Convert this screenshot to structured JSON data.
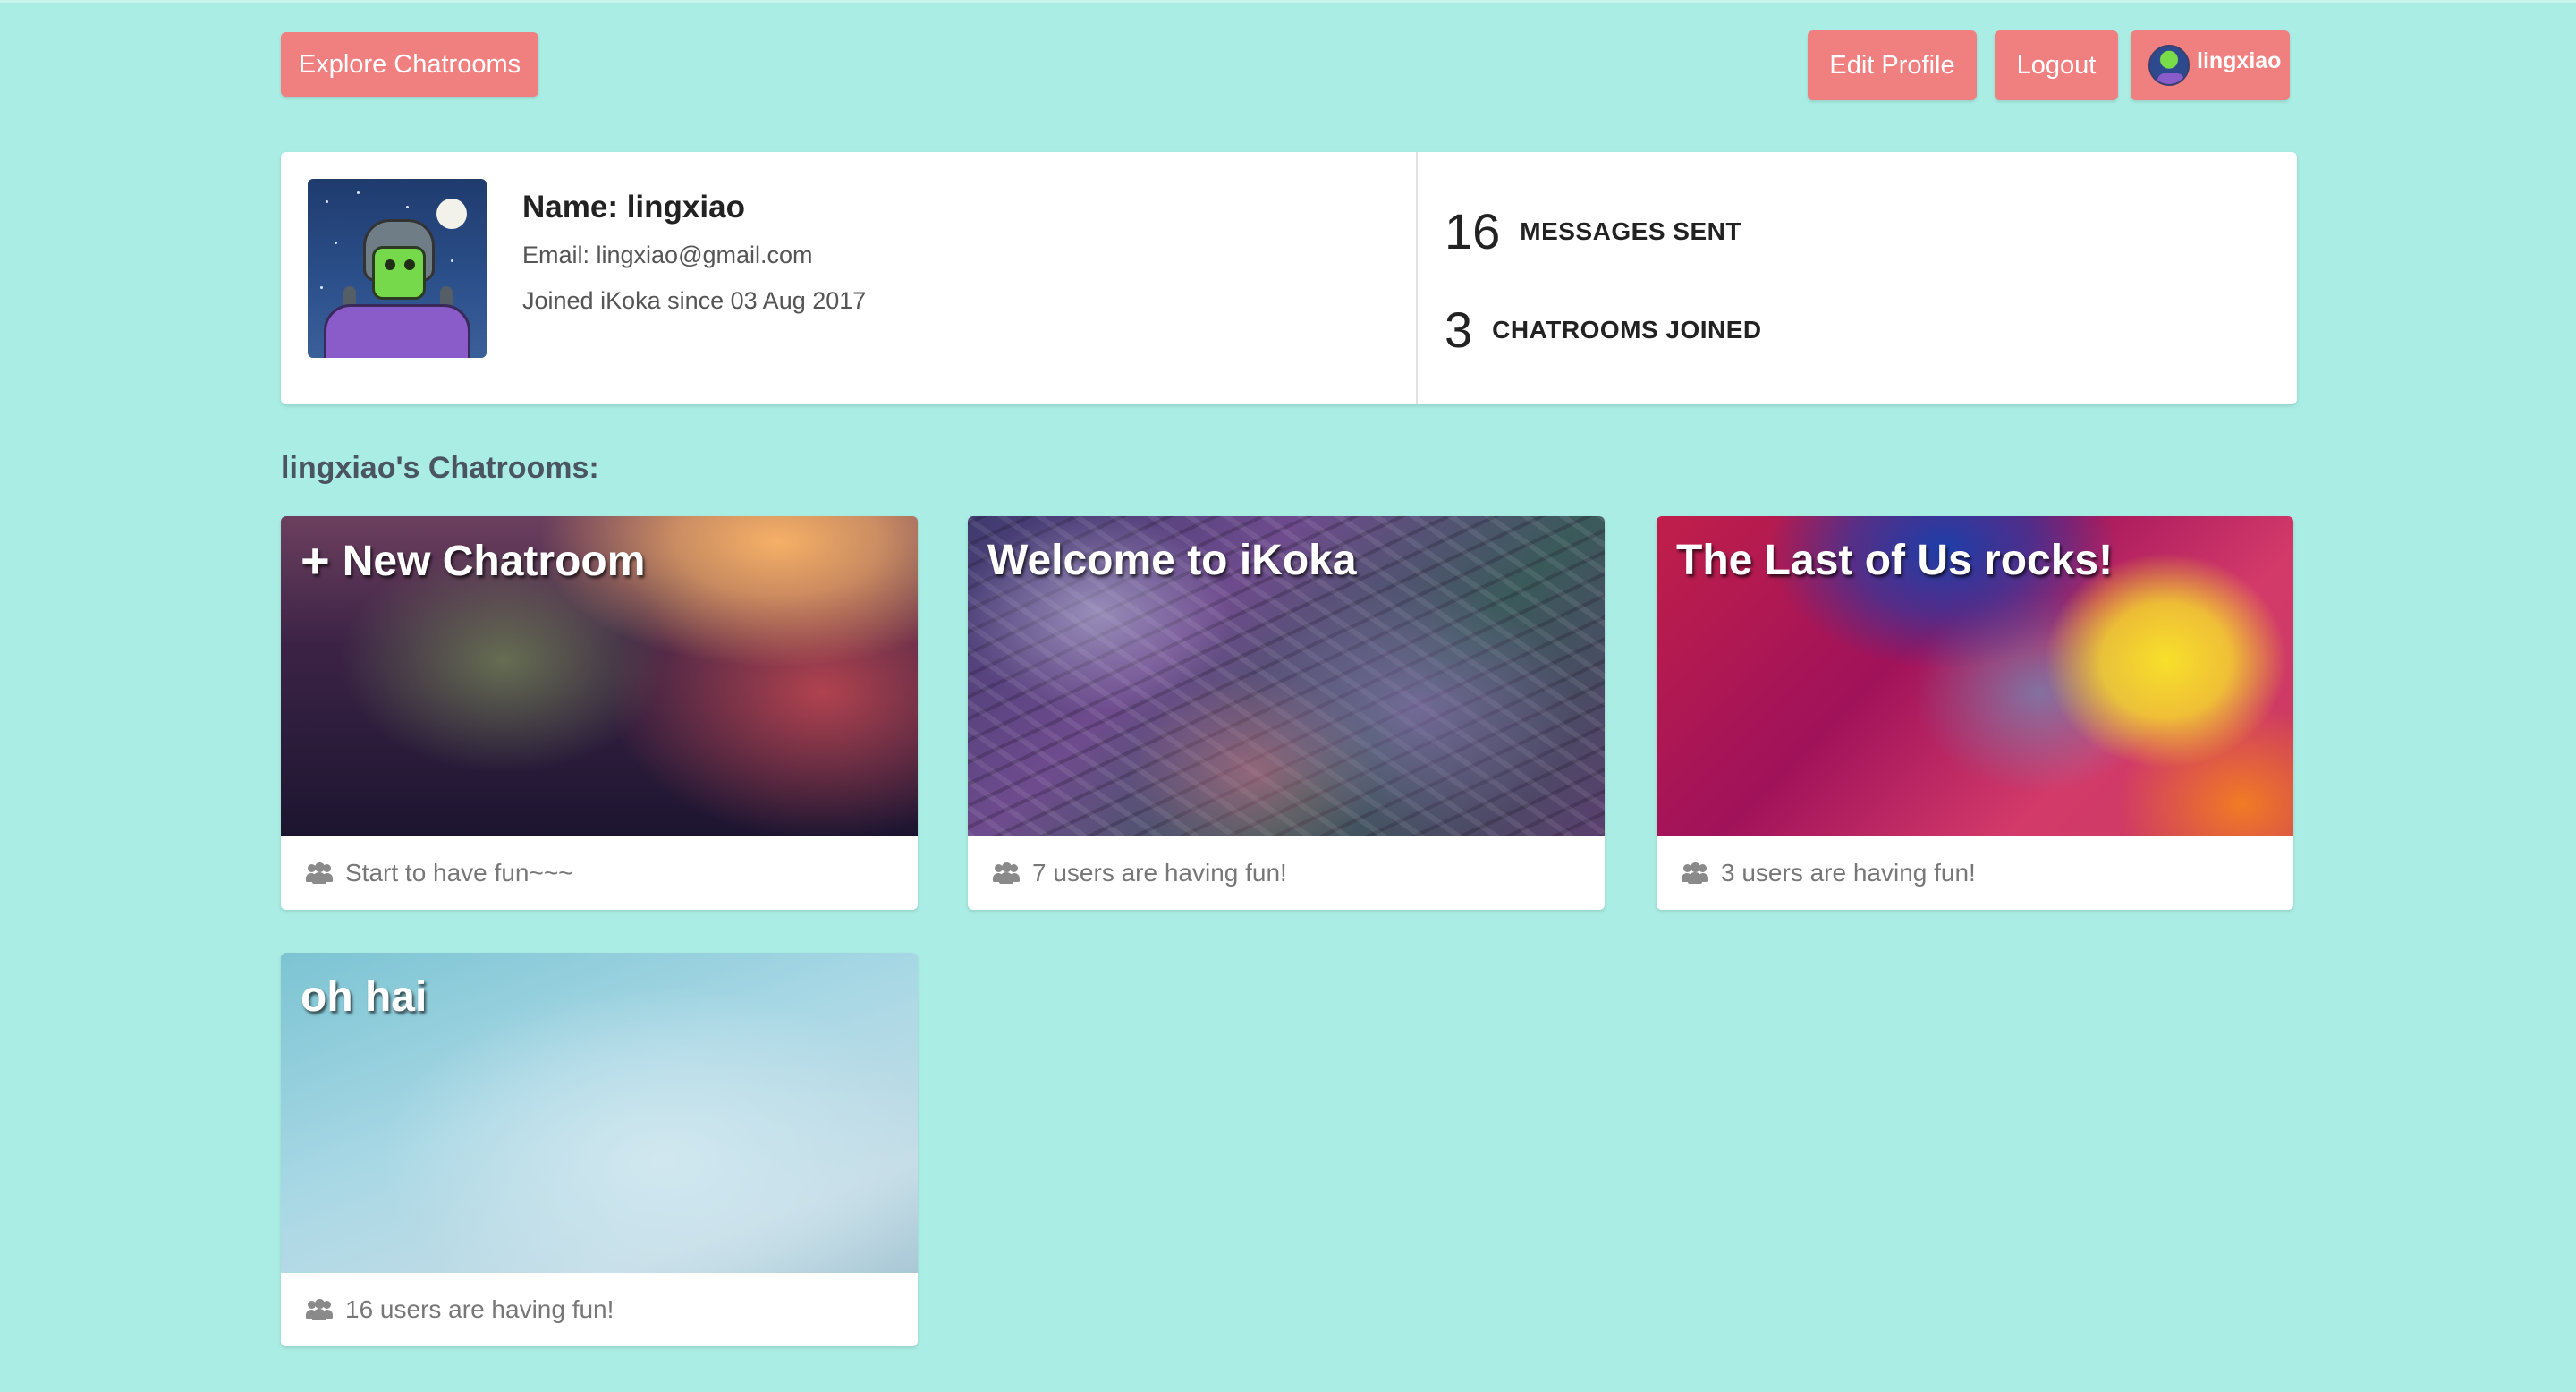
{
  "nav": {
    "explore_label": "Explore Chatrooms",
    "edit_profile_label": "Edit Profile",
    "logout_label": "Logout",
    "user_label": "lingxiao"
  },
  "profile": {
    "name": "Name: lingxiao",
    "email": "Email: lingxiao@gmail.com",
    "joined": "Joined iKoka since 03 Aug 2017",
    "stats": [
      {
        "number": "16",
        "label": "MESSAGES SENT"
      },
      {
        "number": "3",
        "label": "CHATROOMS JOINED"
      }
    ]
  },
  "section_title": "lingxiao's Chatrooms:",
  "chatrooms": [
    {
      "title": "New Chatroom",
      "footer": "Start to have fun~~~",
      "icon": "plus-icon"
    },
    {
      "title": "Welcome to iKoka",
      "footer": "7 users are having fun!"
    },
    {
      "title": "The Last of Us rocks!",
      "footer": "3 users are having fun!"
    },
    {
      "title": "oh hai",
      "footer": "16 users are having fun!"
    }
  ],
  "colors": {
    "page_background": "#aaede4",
    "button": "#f08080",
    "card": "#ffffff"
  }
}
